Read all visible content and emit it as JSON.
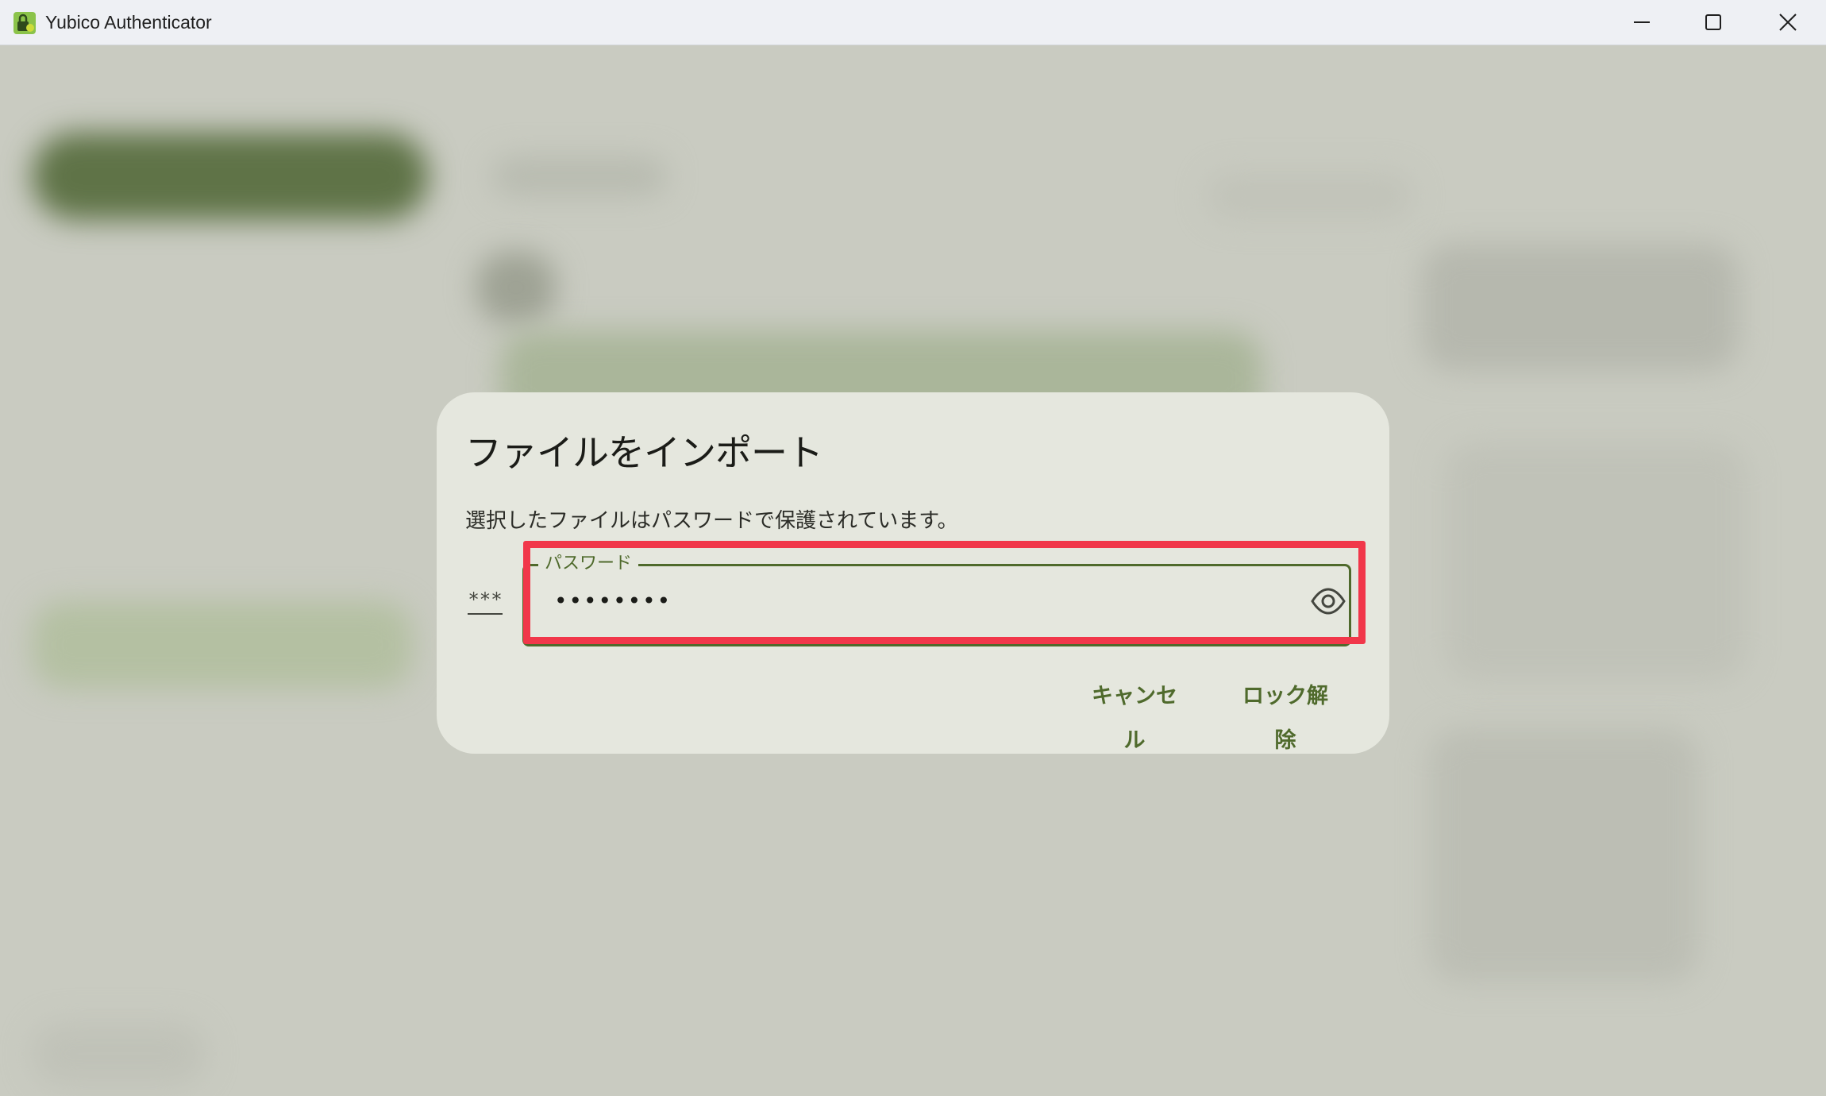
{
  "window": {
    "title": "Yubico Authenticator",
    "icons": {
      "app": "yubico-lock-icon",
      "minimize": "minimize-icon",
      "maximize": "maximize-icon",
      "close": "close-icon"
    }
  },
  "dialog": {
    "title": "ファイルをインポート",
    "message": "選択したファイルはパスワードで保護されています。",
    "password_field": {
      "label": "パスワード",
      "value": "••••••••",
      "prefix_icon_text": "***",
      "toggle_icon": "eye-icon"
    },
    "buttons": {
      "cancel": "キャンセル",
      "unlock": "ロック解除"
    }
  },
  "colors": {
    "accent": "#4f6a2c",
    "dialog_bg": "#e5e7de",
    "highlight": "#f1374a"
  }
}
